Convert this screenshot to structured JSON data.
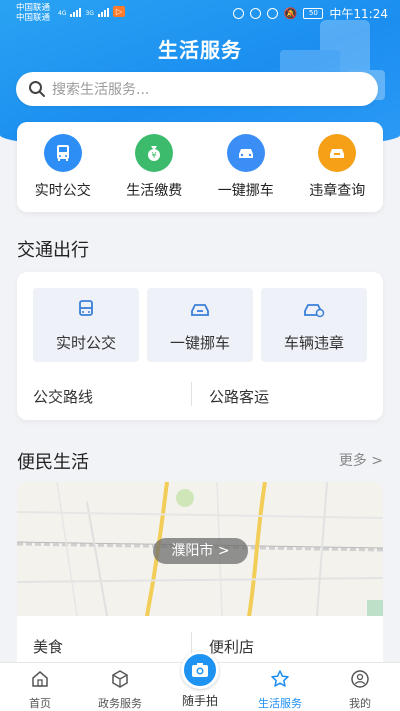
{
  "status_bar": {
    "carrier_1": "中国联通",
    "carrier_2": "中国联通",
    "net_1": "4G",
    "net_2": "3G",
    "battery": "50",
    "time": "中午11:24"
  },
  "header": {
    "title": "生活服务",
    "search_placeholder": "搜索生活服务..."
  },
  "quick_services": [
    {
      "label": "实时公交",
      "icon": "bus-icon",
      "color": "#2d8ef5"
    },
    {
      "label": "生活缴费",
      "icon": "money-bag-icon",
      "color": "#3dbb6c"
    },
    {
      "label": "一键挪车",
      "icon": "car-icon",
      "color": "#3a8ef5"
    },
    {
      "label": "违章查询",
      "icon": "car-violation-icon",
      "color": "#f5a017"
    }
  ],
  "traffic": {
    "title": "交通出行",
    "tiles": [
      {
        "label": "实时公交",
        "icon": "bus-icon"
      },
      {
        "label": "一键挪车",
        "icon": "car-icon"
      },
      {
        "label": "车辆违章",
        "icon": "car-violation-icon"
      }
    ],
    "links": [
      "公交路线",
      "公路客运"
    ]
  },
  "life": {
    "title": "便民生活",
    "more": "更多 >",
    "city": "濮阳市 >",
    "links": [
      "美食",
      "便利店"
    ]
  },
  "bottom_nav": [
    {
      "label": "首页",
      "icon": "home-icon"
    },
    {
      "label": "政务服务",
      "icon": "cube-icon"
    },
    {
      "label": "随手拍",
      "icon": "camera-icon"
    },
    {
      "label": "生活服务",
      "icon": "star-icon",
      "active": true
    },
    {
      "label": "我的",
      "icon": "user-icon"
    }
  ],
  "colors": {
    "primary": "#1d8ef0",
    "background": "#f2f3f7"
  }
}
